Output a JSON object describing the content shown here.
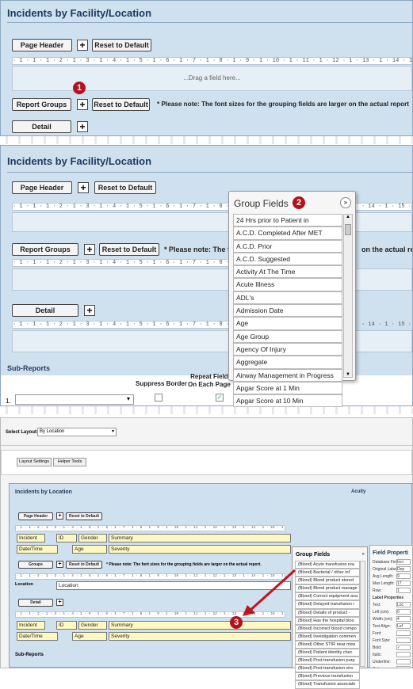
{
  "panel1": {
    "title": "Incidents by Facility/Location",
    "page_header": "Page Header",
    "reset": "Reset to Default",
    "ruler": "· 1 · 1 · 1 · 2 · 1 · 3 · 1 · 4 · 1 · 5 · 1 · 6 · 1 · 7 · 1 · 8 · 1 · 9 · 1 · 10 · 1 · 11 · 1 · 12 · 1 · 13 · 1 · 14 · 1 · 15 · 1 · 16",
    "drag_hint": "...Drag a field here...",
    "badge": "1",
    "report_groups": "Report Groups",
    "note": "* Please note: The font sizes for the grouping fields are larger on the actual report",
    "detail": "Detail"
  },
  "panel2": {
    "title": "Incidents by Facility/Location",
    "page_header": "Page Header",
    "reset": "Reset to Default",
    "ruler": "· 1 · 1 · 1 · 2 · 1 · 3 · 1 · 4 · 1 · 5 · 1 · 6 · 1 · 7 · 1 · 8 ·",
    "ruler_right": "· 14 · 1 · 15 ·",
    "report_groups": "Report Groups",
    "note_left": "* Please note: The fo",
    "note_right": "on the actual re",
    "detail": "Detail",
    "sub_reports": "Sub-Reports",
    "suppress_border": "Suppress Border",
    "repeat_field": "Repeat Field\nOn Each Page",
    "row_num": "1.",
    "group_fields_title": "Group Fields",
    "badge": "2",
    "group_fields": [
      "24 Hrs prior to Patient in",
      "A.C.D. Completed After MET",
      "A.C.D. Prior",
      "A.C.D. Suggested",
      "Activity At The Time",
      "Acute Illness",
      "ADL's",
      "Admission Date",
      "Age",
      "Age Group",
      "Agency Of Injury",
      "Aggregate",
      "Airway Management in Progress",
      "Apgar Score at 1 Min",
      "Apgar Score at 10 Min"
    ]
  },
  "panel3": {
    "select_layout_label": "Select Layout:",
    "select_layout_value": "By Location",
    "layout_settings": "Layout Settings",
    "helper_tools": "Helper Tools",
    "title": "Incidents by Location",
    "acuity": "Acuity",
    "page_header": "Page Header",
    "reset": "Reset to Default",
    "groups": "Groups",
    "note": "* Please note: The font sizes for the grouping fields are larger on the actual report.",
    "detail": "Detail",
    "sub_reports": "Sub-Reports",
    "badge": "3",
    "ruler": "· 1 · 1 · 2 · 1 · 3 · 1 · 4 · 1 · 5 · 1 · 6 · 1 · 7 · 1 · 8 · 1 · 9 · 1 · 10 · 1 · 11 · 1 · 12 · 1 · 13 · 1 · 14 · 1 · 15 · 1 · 16 · 1 · 17",
    "header_fields": {
      "incident": "Incident",
      "id": "ID",
      "gender": "Gender",
      "summary": "Summary",
      "datetime": "Date/Time",
      "age": "Age",
      "severity": "Severity"
    },
    "group_fields_row": {
      "location_label": "Location",
      "location_field": "Location"
    },
    "group_fields_title": "Group Fields",
    "group_fields": [
      "(Blood) Acute transfusion rea",
      "(Blood) Bacterial / other inf",
      "(Blood) Blood product stored",
      "(Blood) Blood product manage",
      "(Blood) Correct equipment ava",
      "(Blood) Delayed transfusion r",
      "(Blood) Details of product -",
      "(Blood) Has the hospital bloo",
      "(Blood) Incorrect blood compo",
      "(Blood) Investigation commen",
      "(Blood) Other STIR near miss",
      "(Blood) Patient identity chec",
      "(Blood) Post-transfusion purp",
      "(Blood) Post-transfusion viro",
      "(Blood) Previous transfusion",
      "(Blood) Transfusion associate"
    ],
    "field_props_title": "Field Properti",
    "field_props": [
      [
        "Database Field:",
        "Inci"
      ],
      [
        "Original Label:",
        "Dep"
      ],
      [
        "Avg Length:",
        "9"
      ],
      [
        "Max Length:",
        "17"
      ],
      [
        "Row:",
        "1"
      ],
      [
        "Label Properties",
        ""
      ],
      [
        "Text:",
        "Loc"
      ],
      [
        "Left (cm):",
        "0"
      ],
      [
        "Width (cm):",
        "4"
      ],
      [
        "Text Align:",
        "Lef"
      ],
      [
        "Font:",
        ""
      ],
      [
        "Font Size:",
        ""
      ],
      [
        "Bold:",
        "✓"
      ],
      [
        "Italic:",
        ""
      ],
      [
        "Underline:",
        ""
      ],
      [
        "Colour:",
        ""
      ]
    ]
  }
}
